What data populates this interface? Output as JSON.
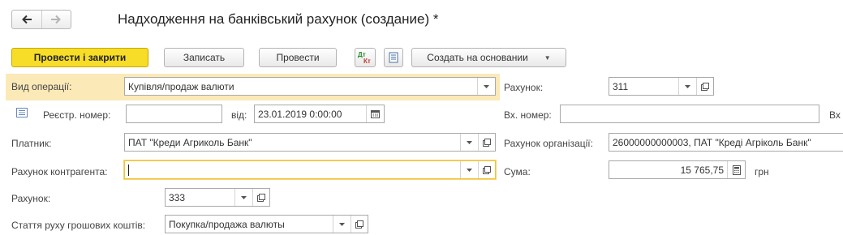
{
  "title": "Надходження на банківський рахунок (создание) *",
  "toolbar": {
    "post_close_label": "Провести і закрити",
    "write_label": "Записать",
    "post_label": "Провести",
    "create_based_label": "Создать на основании"
  },
  "form": {
    "operation_type": {
      "label": "Вид операції:",
      "value": "Купівля/продаж валюти"
    },
    "reg_number": {
      "label": "Реєстр. номер:",
      "value": ""
    },
    "date": {
      "label": "від:",
      "value": "23.01.2019  0:00:00"
    },
    "payer": {
      "label": "Платник:",
      "value": "ПАТ \"Креди Агриколь Банк\""
    },
    "counterparty_account": {
      "label": "Рахунок контрагента:",
      "value": ""
    },
    "account_left": {
      "label": "Рахунок:",
      "value": "333"
    },
    "cash_flow_item": {
      "label": "Стаття руху грошових коштів:",
      "value": "Покупка/продажа валюты"
    },
    "account_right": {
      "label": "Рахунок:",
      "value": "311"
    },
    "incoming_number": {
      "label": "Вх. номер:",
      "value": "",
      "label_cut": "Вх"
    },
    "org_account": {
      "label": "Рахунок організації:",
      "value": "26000000000003, ПАТ \"Креді Агріколь Банк\""
    },
    "amount": {
      "label": "Сума:",
      "value": "15 765,75",
      "currency": "грн"
    }
  },
  "colors": {
    "primary_button": "#f7dd27",
    "highlight_row": "#fbe9b7",
    "focus_border": "#f0c43b"
  }
}
